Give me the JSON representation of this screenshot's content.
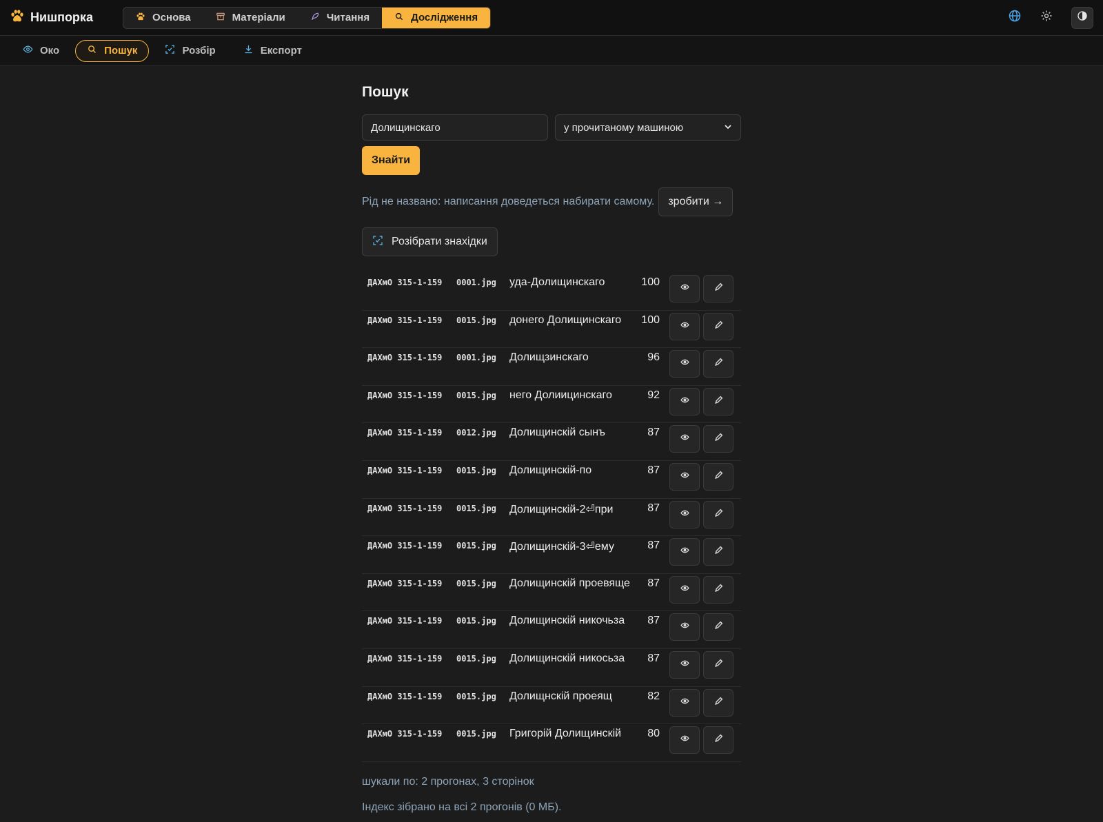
{
  "app": {
    "title": "Нишпорка",
    "colors": {
      "accent": "#f9b43f",
      "background": "#1c1c1c",
      "muted_text": "#8ea4b8"
    }
  },
  "main_tabs": [
    {
      "label": "Основа",
      "icon": "paw-icon",
      "active": false
    },
    {
      "label": "Матеріали",
      "icon": "archive-icon",
      "active": false
    },
    {
      "label": "Читання",
      "icon": "feather-icon",
      "active": false
    },
    {
      "label": "Дослідження",
      "icon": "search-icon",
      "active": true
    }
  ],
  "top_right": {
    "language_icon": "globe-icon",
    "settings_icon": "gear-icon",
    "theme_icon": "contrast-icon"
  },
  "sub_tabs": [
    {
      "label": "Око",
      "icon": "eye-icon",
      "active": false
    },
    {
      "label": "Пошук",
      "icon": "search-icon",
      "active": true
    },
    {
      "label": "Розбір",
      "icon": "scan-icon",
      "active": false
    },
    {
      "label": "Експорт",
      "icon": "download-icon",
      "active": false
    }
  ],
  "search": {
    "title": "Пошук",
    "query": "Долищинскаго",
    "scope_selected": "у прочитаному машиною",
    "find_label": "Знайти",
    "notice": "Рід не названо: написання доведеться набирати самому.",
    "make_label": "зробити →",
    "parse_label": "Розібрати знахідки"
  },
  "results": [
    {
      "source": "ДАХмО 315-1-159",
      "file": "0001.jpg",
      "match": "уда-Долищинскаго",
      "score": "100"
    },
    {
      "source": "ДАХмО 315-1-159",
      "file": "0015.jpg",
      "match": "донего Долищинскаго",
      "score": "100"
    },
    {
      "source": "ДАХмО 315-1-159",
      "file": "0001.jpg",
      "match": "Долищзинскаго",
      "score": "96"
    },
    {
      "source": "ДАХмО 315-1-159",
      "file": "0015.jpg",
      "match": "него Долиицинскаго",
      "score": "92"
    },
    {
      "source": "ДАХмО 315-1-159",
      "file": "0012.jpg",
      "match": "Долищинскій сынъ",
      "score": "87"
    },
    {
      "source": "ДАХмО 315-1-159",
      "file": "0015.jpg",
      "match": "Долищинскій-по",
      "score": "87"
    },
    {
      "source": "ДАХмО 315-1-159",
      "file": "0015.jpg",
      "match": "Долищинскій-2⏎при",
      "score": "87"
    },
    {
      "source": "ДАХмО 315-1-159",
      "file": "0015.jpg",
      "match": "Долищинскій-3⏎ему",
      "score": "87"
    },
    {
      "source": "ДАХмО 315-1-159",
      "file": "0015.jpg",
      "match": "Долищинскій проевяще",
      "score": "87"
    },
    {
      "source": "ДАХмО 315-1-159",
      "file": "0015.jpg",
      "match": "Долищинскій никочьза",
      "score": "87"
    },
    {
      "source": "ДАХмО 315-1-159",
      "file": "0015.jpg",
      "match": "Долищинскій никосьза",
      "score": "87"
    },
    {
      "source": "ДАХмО 315-1-159",
      "file": "0015.jpg",
      "match": "Долищнскій проеящ",
      "score": "82"
    },
    {
      "source": "ДАХмО 315-1-159",
      "file": "0015.jpg",
      "match": "Григорій Долищинскій",
      "score": "80"
    }
  ],
  "row_actions": {
    "view_icon": "eye-icon",
    "edit_icon": "pencil-icon"
  },
  "footer": {
    "searched": "шукали по: 2 прогонах, 3 сторінок",
    "index": "Індекс зібрано на всі 2 прогонів (0 МБ)."
  }
}
